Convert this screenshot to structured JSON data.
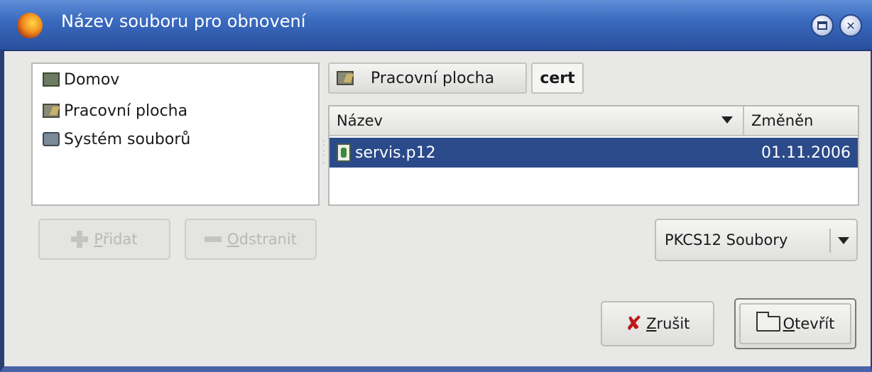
{
  "window": {
    "title": "Název souboru pro obnovení"
  },
  "places": {
    "items": [
      {
        "label": "Domov",
        "icon": "home-folder-icon"
      },
      {
        "label": "Pracovní plocha",
        "icon": "desktop-icon"
      },
      {
        "label": "Systém souborů",
        "icon": "filesystem-icon"
      }
    ]
  },
  "pathbar": {
    "crumbs": [
      "Pracovní plocha",
      "cert"
    ]
  },
  "filelist": {
    "columns": [
      "Název",
      "Změněn"
    ],
    "rows": [
      {
        "name": "servis.p12",
        "modified": "01.11.2006",
        "selected": true
      }
    ]
  },
  "buttons": {
    "add_prefix": "",
    "add_underlined": "P",
    "add_rest": "řidat",
    "remove_underlined": "O",
    "remove_rest": "dstranit",
    "cancel_underlined": "Z",
    "cancel_rest": "rušit",
    "open_underlined": "O",
    "open_rest": "tevřít"
  },
  "filter": {
    "selected": "PKCS12 Soubory"
  },
  "colors": {
    "selection": "#2b4a8a",
    "titlebar": "#3b6bc0"
  }
}
